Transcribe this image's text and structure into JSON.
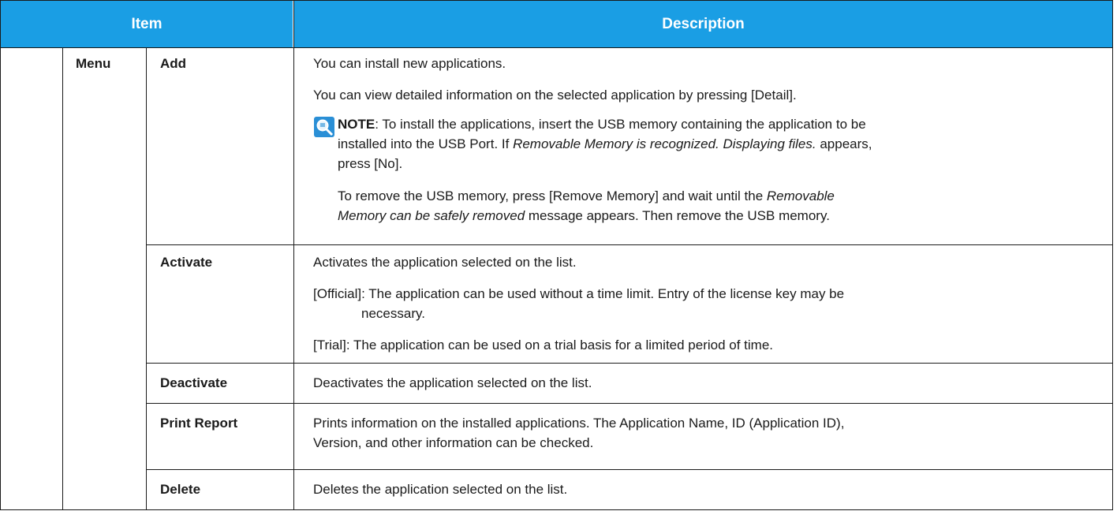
{
  "header": {
    "item": "Item",
    "description": "Description"
  },
  "rows": [
    {
      "group": "Menu",
      "item": "Add",
      "lines": [
        "You can install new applications.",
        "You can view detailed information on the selected application by pressing [Detail]."
      ],
      "note": {
        "label": "NOTE",
        "line1": ": To install the applications, insert the USB memory containing the application to be",
        "line2a": "installed into the USB Port. If ",
        "line2b": "Removable Memory is recognized. Displaying files.",
        "line2c": " appears,",
        "line3": "press [No].",
        "line4a": "To remove the USB memory, press [Remove Memory] and wait until the ",
        "line4b": "Removable",
        "line5a": "Memory can be safely removed",
        "line5b": " message appears. Then remove the USB memory."
      }
    },
    {
      "item": "Activate",
      "lines": [
        "Activates the application selected on the list.",
        "[Official]: The application can be used without a time limit. Entry of the license key may be",
        "necessary.",
        "[Trial]: The application can be used on a trial basis for a limited period of time."
      ]
    },
    {
      "item": "Deactivate",
      "lines": [
        "Deactivates the application selected on the list."
      ]
    },
    {
      "item": "Print Report",
      "lines": [
        "Prints information on the installed applications. The Application Name, ID (Application ID),",
        "Version, and other information can be checked."
      ]
    },
    {
      "item": "Delete",
      "lines": [
        "Deletes the application selected on the list."
      ]
    }
  ],
  "colors": {
    "header_bg": "#1a9ee4",
    "header_text": "#ffffff",
    "rule": "#1a1a1a",
    "note_icon": "#2a8fd6"
  },
  "icons": {
    "note": "note-magnifier-icon"
  }
}
